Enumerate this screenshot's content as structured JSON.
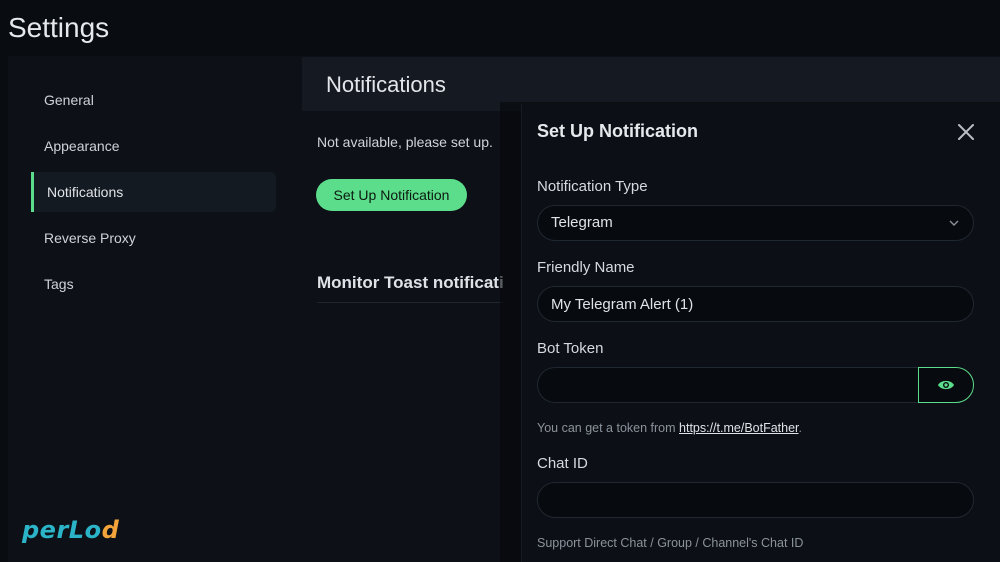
{
  "page": {
    "title": "Settings"
  },
  "sidebar": {
    "items": [
      {
        "label": "General",
        "active": false
      },
      {
        "label": "Appearance",
        "active": false
      },
      {
        "label": "Notifications",
        "active": true
      },
      {
        "label": "Reverse Proxy",
        "active": false
      },
      {
        "label": "Tags",
        "active": false
      }
    ]
  },
  "content": {
    "title": "Notifications",
    "not_available": "Not available, please set up.",
    "setup_button": "Set Up Notification",
    "toast_heading": "Monitor Toast notifications"
  },
  "modal": {
    "title": "Set Up Notification",
    "type_label": "Notification Type",
    "type_value": "Telegram",
    "friendly_name_label": "Friendly Name",
    "friendly_name_value": "My Telegram Alert (1)",
    "bot_token_label": "Bot Token",
    "bot_token_value": "",
    "token_hint_prefix": "You can get a token from",
    "token_hint_link": "https://t.me/BotFather",
    "token_hint_suffix": ".",
    "chat_id_label": "Chat ID",
    "chat_id_value": "",
    "chat_id_hint": "Support Direct Chat / Group / Channel's Chat ID"
  },
  "logo": {
    "text_main": "perLo",
    "text_tail": "d"
  },
  "colors": {
    "accent": "#5cdd8b",
    "background": "#090c10",
    "panel": "#0d1117",
    "logo": "#2bb3c8",
    "logo_dot": "#f2a33a"
  },
  "icons": {
    "close": "close-icon",
    "chevron": "chevron-down-icon",
    "visibility": "eye-icon"
  }
}
